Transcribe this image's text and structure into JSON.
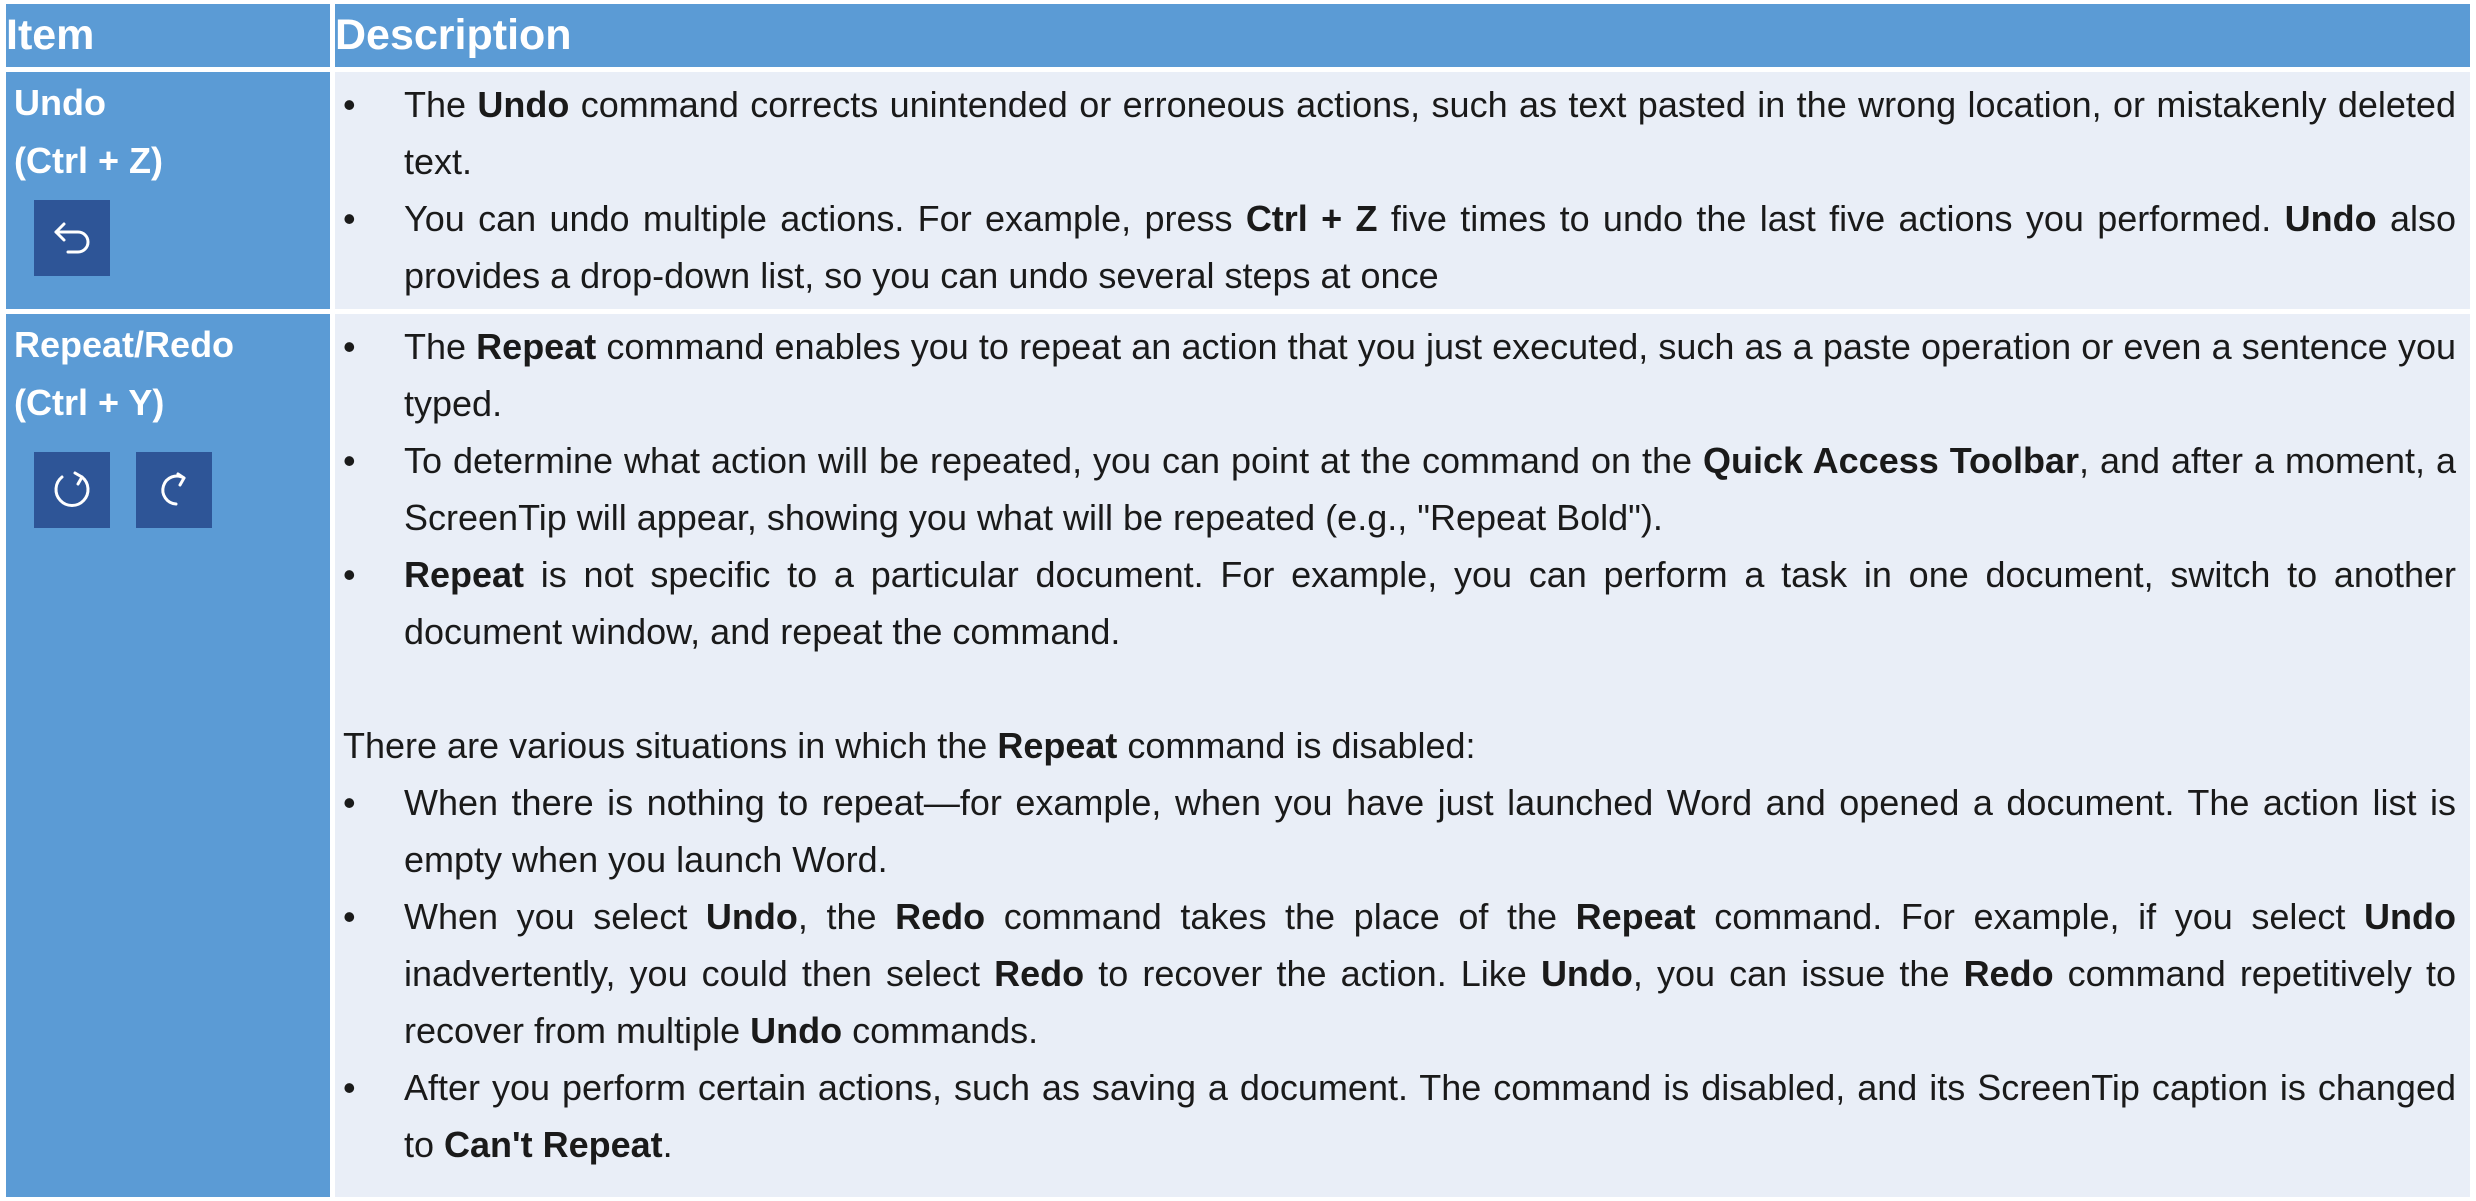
{
  "header": {
    "item": "Item",
    "description": "Description"
  },
  "undo": {
    "title_line1": "Undo",
    "title_line2": "(Ctrl + Z)",
    "icon": "undo-icon",
    "bullets": [
      [
        {
          "t": "The "
        },
        {
          "t": "Undo",
          "b": true
        },
        {
          "t": " command corrects unintended or erroneous actions, such as text pasted in the wrong location, or mistakenly deleted text."
        }
      ],
      [
        {
          "t": "You can undo multiple actions. For example, press "
        },
        {
          "t": "Ctrl + Z",
          "b": true
        },
        {
          "t": " five times to undo the last five actions you performed. "
        },
        {
          "t": "Undo",
          "b": true
        },
        {
          "t": " also provides a drop-down list, so you can undo several steps at once"
        }
      ]
    ]
  },
  "repeat": {
    "title_line1": "Repeat/Redo",
    "title_line2": "(Ctrl + Y)",
    "icons": [
      "repeat-icon",
      "redo-icon"
    ],
    "bullets": [
      [
        {
          "t": "The "
        },
        {
          "t": "Repeat",
          "b": true
        },
        {
          "t": " command enables you to repeat an action that you just executed, such as a paste operation or even a sentence you typed."
        }
      ],
      [
        {
          "t": "To determine what action will be repeated, you can point at the command on the "
        },
        {
          "t": "Quick Access Toolbar",
          "b": true
        },
        {
          "t": ", and after a moment, a ScreenTip will appear, showing you what will be repeated (e.g., \"Repeat Bold\")."
        }
      ],
      [
        {
          "t": "Repeat",
          "b": true
        },
        {
          "t": " is not specific to a particular document. For example, you can perform a task in one document, switch to another document window, and repeat the command."
        }
      ]
    ],
    "intro": [
      {
        "t": "There are various situations in which the "
      },
      {
        "t": "Repeat",
        "b": true
      },
      {
        "t": " command is disabled:"
      }
    ],
    "disabled_bullets": [
      [
        {
          "t": "When there is nothing to repeat—for example, when you have just launched Word and opened a document. The action list is empty when you launch Word."
        }
      ],
      [
        {
          "t": "When you select "
        },
        {
          "t": "Undo",
          "b": true
        },
        {
          "t": ", the "
        },
        {
          "t": "Redo",
          "b": true
        },
        {
          "t": " command takes the place of the "
        },
        {
          "t": "Repeat",
          "b": true
        },
        {
          "t": " command. For example, if you select "
        },
        {
          "t": "Undo",
          "b": true
        },
        {
          "t": " inadvertently, you could then select "
        },
        {
          "t": "Redo",
          "b": true
        },
        {
          "t": " to recover the action. Like "
        },
        {
          "t": "Undo",
          "b": true
        },
        {
          "t": ", you can issue the "
        },
        {
          "t": "Redo",
          "b": true
        },
        {
          "t": " command repetitively to recover from multiple "
        },
        {
          "t": "Undo",
          "b": true
        },
        {
          "t": " commands."
        }
      ],
      [
        {
          "t": "After you perform certain actions, such as saving a document. The command is disabled, and its ScreenTip caption is changed to "
        },
        {
          "t": "Can't Repeat",
          "b": true
        },
        {
          "t": "."
        }
      ]
    ]
  },
  "colors": {
    "header_bg": "#5b9bd5",
    "item_bg": "#5b9bd5",
    "desc_bg": "#e9eef7",
    "icon_bg": "#2e5597"
  }
}
